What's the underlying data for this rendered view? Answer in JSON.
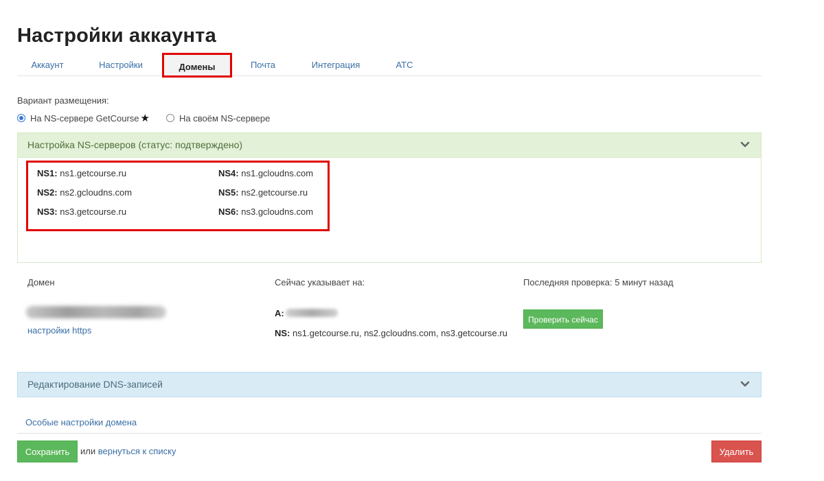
{
  "page_title": "Настройки аккаунта",
  "tabs": [
    {
      "label": "Аккаунт"
    },
    {
      "label": "Настройки"
    },
    {
      "label": "Домены",
      "active": true
    },
    {
      "label": "Почта"
    },
    {
      "label": "Интеграция"
    },
    {
      "label": "АТС"
    }
  ],
  "placement": {
    "label": "Вариант размещения:",
    "options": [
      {
        "label": "На NS-сервере GetCourse",
        "star": "★",
        "checked": true
      },
      {
        "label": "На своём NS-сервере",
        "checked": false
      }
    ]
  },
  "ns_panel": {
    "title": "Настройка NS-серверов (статус: подтверждено)",
    "servers": [
      {
        "key": "NS1:",
        "value": "ns1.getcourse.ru"
      },
      {
        "key": "NS2:",
        "value": "ns2.gcloudns.com"
      },
      {
        "key": "NS3:",
        "value": "ns3.getcourse.ru"
      },
      {
        "key": "NS4:",
        "value": "ns1.gcloudns.com"
      },
      {
        "key": "NS5:",
        "value": "ns2.getcourse.ru"
      },
      {
        "key": "NS6:",
        "value": "ns3.gcloudns.com"
      }
    ]
  },
  "domain_table": {
    "col_domain": "Домен",
    "col_points_to": "Сейчас указывает на:",
    "col_last_check": "Последняя проверка: 5 минут назад",
    "https_link": "настройки https",
    "a_label": "A:",
    "ns_label": "NS:",
    "ns_value": "ns1.getcourse.ru, ns2.gcloudns.com, ns3.getcourse.ru",
    "check_button": "Проверить сейчас"
  },
  "dns_panel": {
    "title": "Редактирование DNS-записей"
  },
  "special_settings_link": "Особые настройки домена",
  "footer": {
    "save_button": "Сохранить",
    "or_text": "или",
    "back_link": "вернуться к списку",
    "delete_button": "Удалить"
  },
  "colors": {
    "link": "#3a6fa6",
    "highlight_border": "#e00000",
    "success_panel": "#e3f1d8",
    "info_panel": "#d9ecf6",
    "button_green": "#5cb85c",
    "button_red": "#d9534f"
  }
}
